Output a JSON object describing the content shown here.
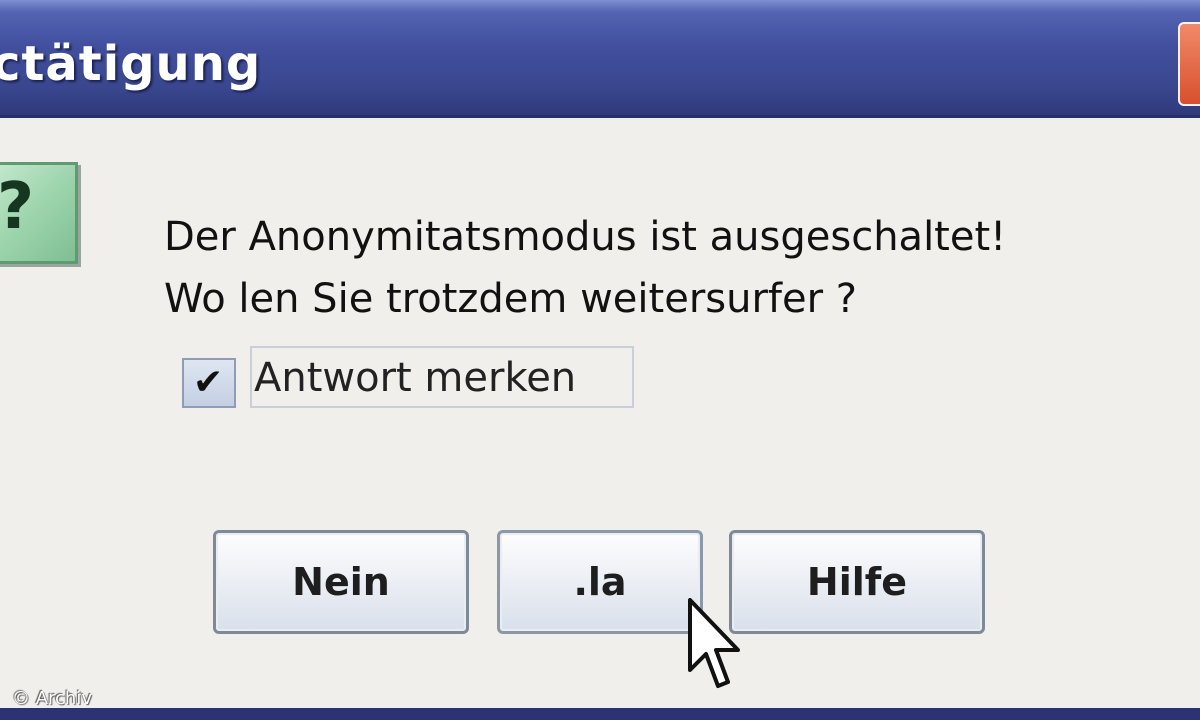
{
  "window": {
    "title": "ctätigung"
  },
  "dialog": {
    "icon": "question-icon",
    "icon_glyph": "?",
    "message_line1": "Der Anonymitatsmodus ist ausgeschaltet!",
    "message_line2": "Wo len Sie trotzdem weitersurfer ?",
    "remember_checkbox": {
      "checked": true,
      "check_glyph": "✔",
      "label": "Antwort merken"
    },
    "buttons": {
      "no": "Nein",
      "yes": ".la",
      "help": "Hilfe"
    }
  },
  "watermark": "© Archiv",
  "colors": {
    "titlebar": "#414f9e",
    "icon_bg": "#9fd5ae",
    "dialog_bg": "#f1efeb"
  }
}
